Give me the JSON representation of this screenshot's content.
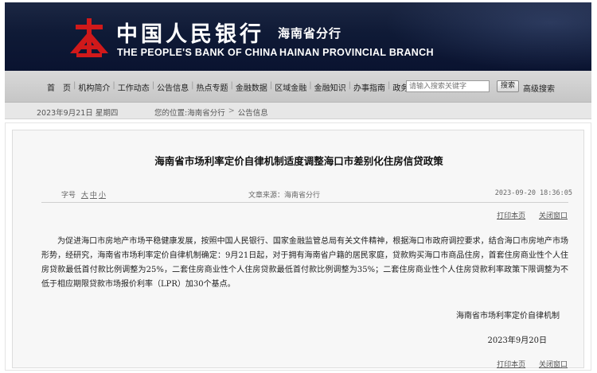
{
  "header": {
    "bank_name_cn": "中国人民银行",
    "branch_cn": "海南省分行",
    "bank_name_en": "THE PEOPLE'S BANK OF CHINA",
    "branch_en": "HAINAN PROVINCIAL BRANCH",
    "brand_color": "#d0191a"
  },
  "nav": {
    "items": [
      "首　页",
      "机构简介",
      "工作动态",
      "公告信息",
      "热点专题",
      "金融数据",
      "区域金融",
      "金融知识",
      "办事指南",
      "政务公开"
    ],
    "search_placeholder": "请输入搜索关键字",
    "search_button": "搜索",
    "advanced_search": "高级搜索"
  },
  "infobar": {
    "date": "2023年9月21日 星期四",
    "location_label": "您的位置:",
    "crumbs": [
      "海南省分行",
      "公告信息"
    ]
  },
  "article": {
    "title": "海南省市场利率定价自律机制适度调整海口市差别化住房信贷政策",
    "font_size_label": "字号",
    "font_sizes": [
      "大",
      "中",
      "小"
    ],
    "source": "文章来源：海南省分行",
    "timestamp": "2023-09-20 18:36:05",
    "print_label": "打印本页",
    "close_label": "关闭窗口",
    "body": "为促进海口市房地产市场平稳健康发展，按照中国人民银行、国家金融监管总局有关文件精神，根据海口市政府调控要求，结合海口市房地产市场形势，经研究，海南省市场利率定价自律机制确定：9月21日起，对于拥有海南省户籍的居民家庭，贷款购买海口市商品住房，首套住房商业性个人住房贷款最低首付款比例调整为25%，二套住房商业性个人住房贷款最低首付款比例调整为35%；二套住房商业性个人住房贷款利率政策下限调整为不低于相应期限贷款市场报价利率（LPR）加30个基点。",
    "signature": "海南省市场利率定价自律机制",
    "sign_date": "2023年9月20日"
  }
}
